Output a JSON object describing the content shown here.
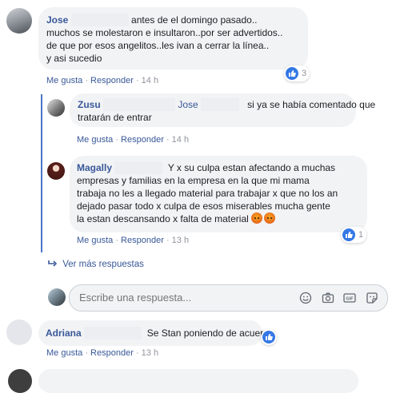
{
  "comment1": {
    "author": "Jose",
    "lines": [
      "antes de el domingo pasado..",
      "muchos se molestaron e insultaron..por ser advertidos..",
      "de que por esos angelitos..les ivan a cerrar la línea..",
      "y asi sucedio"
    ],
    "like_label": "Me gusta",
    "reply_label": "Responder",
    "time": "14 h",
    "reaction_count": "3"
  },
  "reply1": {
    "author": "Zusu",
    "mention": "Jose",
    "line1": "si ya se había comentado que",
    "line2": "tratarán de entrar",
    "like_label": "Me gusta",
    "reply_label": "Responder",
    "time": "14 h"
  },
  "reply2": {
    "author": "Magally",
    "lines": [
      "Y x su culpa estan afectando a muchas",
      "empresas y familias en la empresa en la que mi mama",
      "trabaja no les a llegado material para trabajar x que no los an",
      "dejado pasar todo x culpa de esos miserables mucha gente",
      "la estan descansando x falta de material"
    ],
    "like_label": "Me gusta",
    "reply_label": "Responder",
    "time": "13 h",
    "reaction_count": "1"
  },
  "more_replies": "Ver más respuestas",
  "reply_box": {
    "placeholder": "Escribe una respuesta..."
  },
  "comment2": {
    "author": "Adriana",
    "text": "Se Stan poniendo de acuerdo",
    "like_label": "Me gusta",
    "reply_label": "Responder",
    "time": "13 h"
  },
  "colors": {
    "link": "#385898",
    "like_blue": "#3578e5",
    "bubble": "#f2f3f5",
    "thread_line": "#4a76c6"
  }
}
